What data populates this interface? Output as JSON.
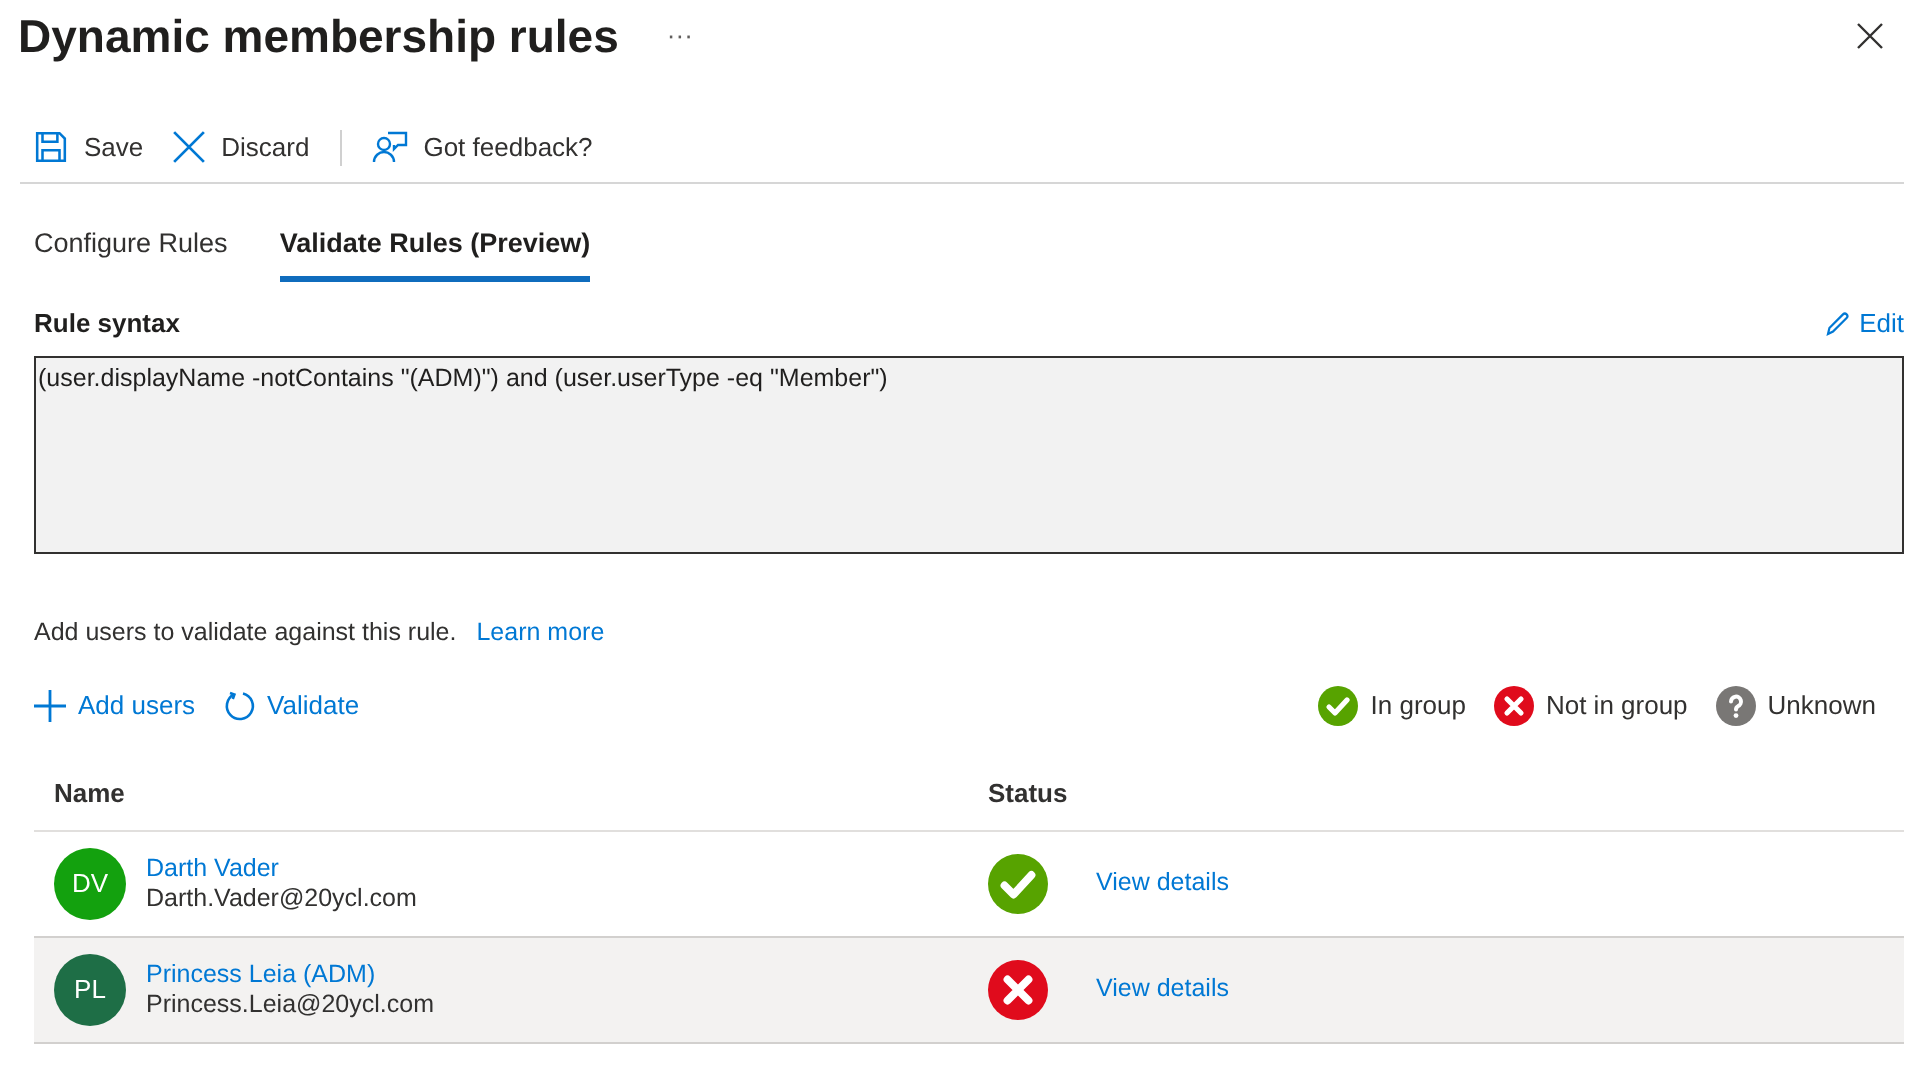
{
  "title": "Dynamic membership rules",
  "more": "···",
  "toolbar": [
    {
      "kind": "save",
      "label": "Save"
    },
    {
      "kind": "discard",
      "label": "Discard"
    },
    {
      "kind": "feedback",
      "label": "Got feedback?"
    }
  ],
  "tabs": [
    {
      "label": "Configure Rules",
      "selected": false
    },
    {
      "label": "Validate Rules (Preview)",
      "selected": true
    }
  ],
  "rule": {
    "label": "Rule syntax",
    "edit": "Edit",
    "value": "(user.displayName -notContains \"(ADM)\") and (user.userType -eq \"Member\")"
  },
  "hint": {
    "text": "Add users to validate against this rule.",
    "link": "Learn more"
  },
  "actions": [
    {
      "kind": "add",
      "label": "Add users"
    },
    {
      "kind": "validate",
      "label": "Validate"
    }
  ],
  "legend": [
    {
      "kind": "in",
      "label": "In group"
    },
    {
      "kind": "out",
      "label": "Not in group"
    },
    {
      "kind": "unknown",
      "label": "Unknown"
    }
  ],
  "table": {
    "columns": [
      "Name",
      "Status"
    ],
    "rows": [
      {
        "initials": "DV",
        "color": "#13a10e",
        "name": "Darth Vader",
        "email": "Darth.Vader@20ycl.com",
        "kind": "in",
        "details": "View details",
        "selected": false
      },
      {
        "initials": "PL",
        "color": "#1e6e46",
        "name": "Princess Leia (ADM)",
        "email": "Princess.Leia@20ycl.com",
        "kind": "out",
        "details": "View details",
        "selected": true
      }
    ]
  }
}
